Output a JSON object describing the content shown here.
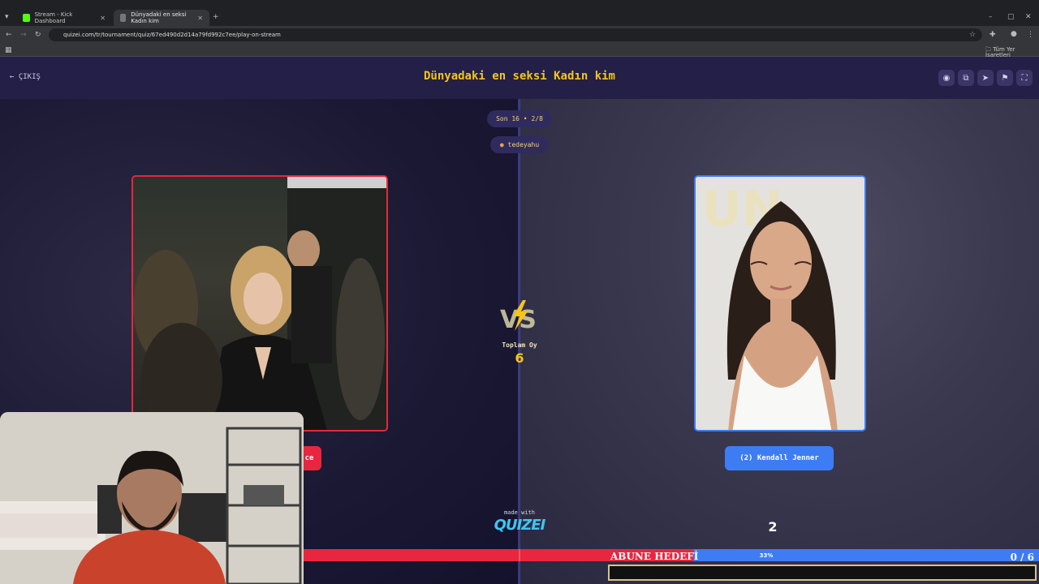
{
  "browser": {
    "tabs": [
      {
        "title": "Stream - Kick Dashboard",
        "favicon_color": "#53fc18"
      },
      {
        "title": "Dünyadaki en seksi Kadın kim",
        "favicon_color": "#777"
      }
    ],
    "url": "quizei.com/tr/tournament/quiz/67ed490d2d14a79fd992c7ee/play-on-stream",
    "bookmarks_label": "Tüm Yer İşaretleri"
  },
  "header": {
    "exit_label": "ÇIKIŞ",
    "title": "Dünyadaki en seksi Kadın kim",
    "icons": [
      "eye-icon",
      "share-icon",
      "send-icon",
      "flag-icon",
      "fullscreen-icon"
    ]
  },
  "match": {
    "round_label": "Son 16 • 2/8",
    "streamer": "tedeyahu",
    "vs_text": "VS",
    "total_votes_label": "Toplam Oy",
    "total_votes": "6",
    "left": {
      "label_visible": "ce",
      "accent": "#e8263f"
    },
    "right": {
      "label": "(2) Kendall Jenner",
      "accent": "#3e7cf3",
      "votes": "2"
    }
  },
  "branding": {
    "made_with": "made with",
    "logo": "QUIZEI"
  },
  "goal": {
    "text": "ABUNE HEDEFİ",
    "percent_label": "33%",
    "progress": 0.33,
    "count": "0 / 6"
  }
}
